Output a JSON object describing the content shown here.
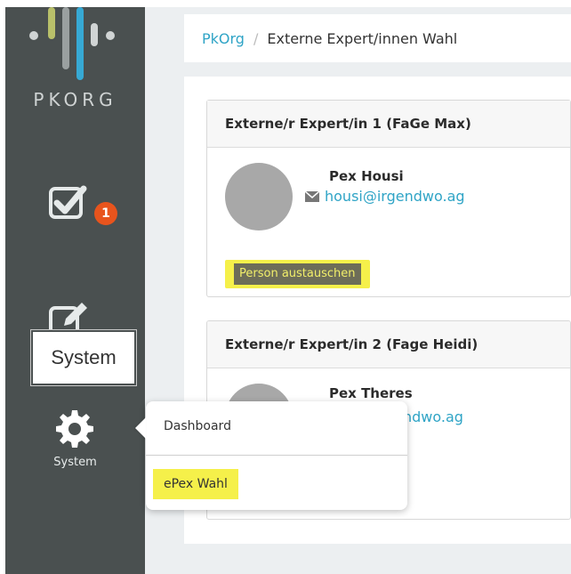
{
  "sidebar": {
    "logo_text": "PKORG",
    "tasks_badge": "1",
    "tooltip": "System",
    "system_label": "System"
  },
  "breadcrumb": {
    "home": "PkOrg",
    "separator": "/",
    "current": "Externe Expert/innen Wahl"
  },
  "cards": [
    {
      "title": "Externe/r Expert/in 1 (FaGe Max)",
      "name": "Pex Housi",
      "email": "housi@irgendwo.ag",
      "button": "Person austauschen"
    },
    {
      "title": "Externe/r Expert/in 2 (Fage Heidi)",
      "name": "Pex Theres",
      "email": "gendwo.ag"
    }
  ],
  "dropdown": {
    "items": [
      "Dashboard",
      "ePex Wahl"
    ]
  },
  "colors": {
    "sidebar": "#4a5050",
    "accent": "#2fa4c6",
    "badge": "#e8541d",
    "highlight": "#f5f04a"
  }
}
